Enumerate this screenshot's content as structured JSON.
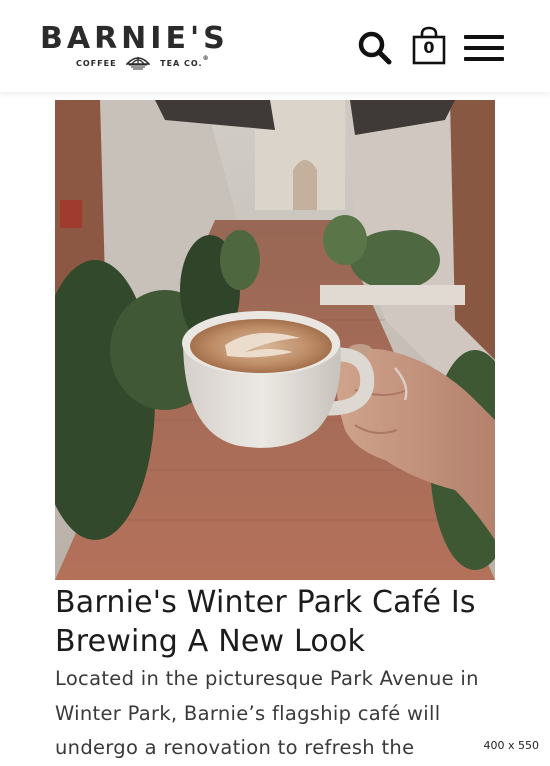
{
  "header": {
    "logo": {
      "wordmark": "BARNIE'S",
      "left_text": "COFFEE",
      "right_text": "TEA CO.",
      "registered_mark": "®"
    },
    "search_icon": "search-icon",
    "cart": {
      "icon": "shopping-bag-icon",
      "count": "0"
    },
    "menu_icon": "hamburger-menu-icon"
  },
  "article": {
    "image_alt": "Hand holding a latte cup in a brick-paved courtyard",
    "title": "Barnie's Winter Park Café Is Brewing A New Look",
    "excerpt": "Located in the picturesque Park Avenue in Winter Park, Barnie’s flagship café will undergo a renovation to refresh the"
  },
  "viewport_badge": "400 x 550",
  "colors": {
    "text": "#1c1c1c",
    "header_bg": "#ffffff",
    "brick": "#b86a52",
    "foliage": "#3e5a36",
    "cup": "#f2f0ec",
    "latte": "#c99a72"
  }
}
